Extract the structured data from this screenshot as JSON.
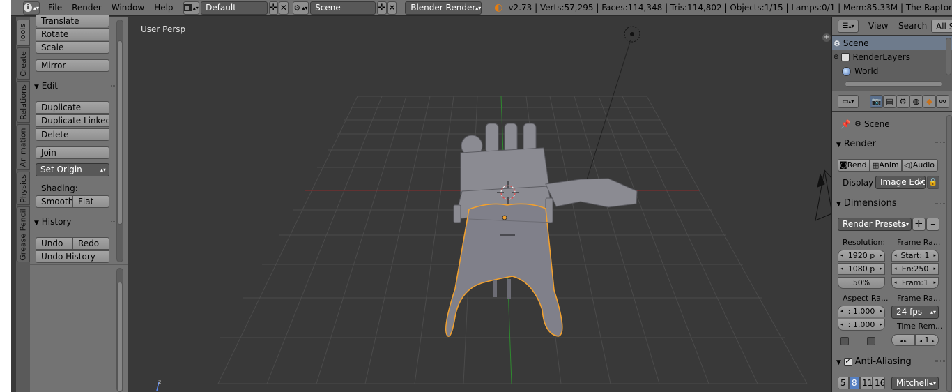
{
  "header": {
    "info_icon": "i",
    "menus": [
      "File",
      "Render",
      "Window",
      "Help"
    ],
    "screen_layout": "Default",
    "scene": "Scene",
    "render_engine": "Blender Render",
    "stats": "v2.73 | Verts:57,295 | Faces:114,348 | Tris:114,802 | Objects:1/15 | Lamps:0/1 | Mem:85.33M | The Raptor"
  },
  "tool_tabs": [
    "Tools",
    "Create",
    "Relations",
    "Animation",
    "Physics",
    "Grease Pencil"
  ],
  "toolshelf": {
    "transform_buttons": [
      "Translate",
      "Rotate",
      "Scale"
    ],
    "mirror": "Mirror",
    "edit_header": "Edit",
    "edit_buttons": [
      "Duplicate",
      "Duplicate Linked",
      "Delete"
    ],
    "join": "Join",
    "set_origin": "Set Origin",
    "shading_label": "Shading:",
    "smooth": "Smooth",
    "flat": "Flat",
    "history_header": "History",
    "undo": "Undo",
    "redo": "Redo",
    "undo_history": "Undo History"
  },
  "viewport": {
    "view_label": "User Persp"
  },
  "outliner": {
    "view_menu": "View",
    "search_menu": "Search",
    "filter": "All S",
    "items": [
      "Scene",
      "RenderLayers",
      "World"
    ]
  },
  "properties": {
    "context_label": "Scene",
    "render_header": "Render",
    "render_buttons": [
      "Rend",
      "Anim",
      "Audio"
    ],
    "display_label": "Display",
    "display_value": "Image Edit",
    "dimensions_header": "Dimensions",
    "render_presets": "Render Presets",
    "resolution_label": "Resolution:",
    "frame_range_label": "Frame Ra...",
    "res_x": "1920 p",
    "res_y": "1080 p",
    "res_pct": "50%",
    "frame_start": "Start: 1",
    "frame_end": "En:250",
    "frame_step": "Fram:1",
    "aspect_label": "Aspect Ra...",
    "frame_rate_label": "Frame Ra...",
    "aspect_x": ": 1.000",
    "aspect_y": ": 1.000",
    "fps": "24 fps",
    "time_remap_label": "Time Rem...",
    "time_remap_value": "1",
    "aa_header": "Anti-Aliasing",
    "aa_samples": [
      "5",
      "8",
      "11",
      "16"
    ],
    "aa_selected": "8",
    "aa_filter": "Mitchell-"
  },
  "colors": {
    "selection_outline": "#f0a030",
    "grid_x_axis": "#8b2a2a",
    "grid_y_axis": "#2f8a2f",
    "model": "#7f7f86"
  }
}
